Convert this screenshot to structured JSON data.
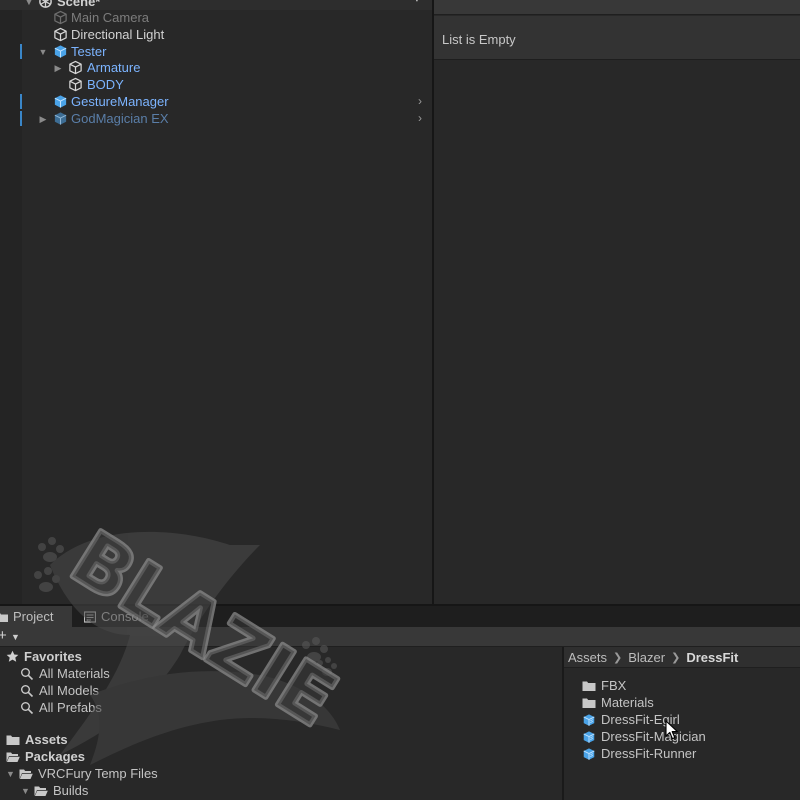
{
  "hierarchy": {
    "scene_label": "Scene*",
    "items": [
      {
        "label": "Main Camera",
        "state": "disabled"
      },
      {
        "label": "Directional Light",
        "state": "normal"
      },
      {
        "label": "Tester",
        "state": "prefab"
      },
      {
        "label": "Armature",
        "state": "prefab"
      },
      {
        "label": "BODY",
        "state": "prefab"
      },
      {
        "label": "GestureManager",
        "state": "prefab"
      },
      {
        "label": "GodMagician EX",
        "state": "prefab-disabled"
      }
    ]
  },
  "inspector": {
    "empty_message": "List is Empty"
  },
  "project": {
    "tabs": [
      {
        "label": "Project",
        "active": true
      },
      {
        "label": "Console",
        "active": false
      }
    ],
    "tree": {
      "favorites_label": "Favorites",
      "favorites": [
        "All Materials",
        "All Models",
        "All Prefabs"
      ],
      "assets_label": "Assets",
      "packages_label": "Packages",
      "packages_children": [
        "VRCFury Temp Files"
      ],
      "vrcfury_children": [
        "Builds"
      ]
    },
    "breadcrumb": [
      "Assets",
      "Blazer",
      "DressFit"
    ],
    "contents": [
      {
        "label": "FBX",
        "type": "folder"
      },
      {
        "label": "Materials",
        "type": "folder"
      },
      {
        "label": "DressFit-Egirl",
        "type": "prefab"
      },
      {
        "label": "DressFit-Magician",
        "type": "prefab"
      },
      {
        "label": "DressFit-Runner",
        "type": "prefab"
      }
    ]
  },
  "watermark": {
    "text": "BLAZIE"
  },
  "colors": {
    "panel_bg": "#282828",
    "prefab_blue": "#7cb4ff",
    "selection_marker": "#3a86c8",
    "toolbar_bg": "#383838"
  }
}
